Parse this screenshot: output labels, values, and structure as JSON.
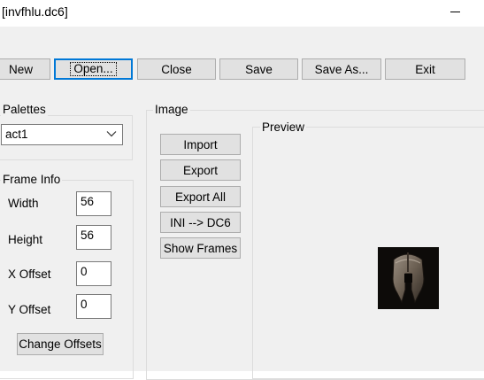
{
  "window": {
    "title": "[invfhlu.dc6]"
  },
  "toolbar": {
    "new": "New",
    "open": "Open...",
    "close": "Close",
    "save": "Save",
    "save_as": "Save As...",
    "exit": "Exit"
  },
  "palettes": {
    "label": "Palettes",
    "selected": "act1"
  },
  "frame_info": {
    "label": "Frame Info",
    "width_label": "Width",
    "width_value": "56",
    "height_label": "Height",
    "height_value": "56",
    "xoffset_label": "X Offset",
    "xoffset_value": "0",
    "yoffset_label": "Y Offset",
    "yoffset_value": "0",
    "change_offsets": "Change Offsets"
  },
  "image": {
    "label": "Image",
    "import": "Import",
    "export": "Export",
    "export_all": "Export All",
    "ini_to_dc6": "INI --> DC6",
    "show_frames": "Show Frames"
  },
  "preview": {
    "label": "Preview",
    "thumbnail_icon": "helmet-icon"
  },
  "colors": {
    "focus": "#0078d7",
    "face": "#f0f0f0",
    "button": "#e1e1e1"
  }
}
